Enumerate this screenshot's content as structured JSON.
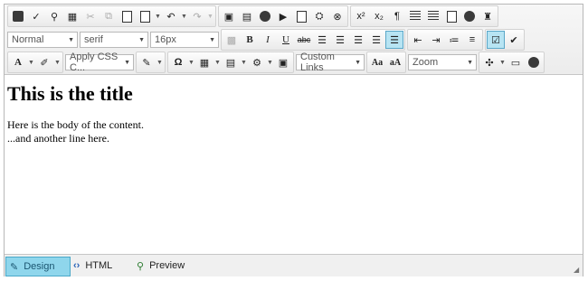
{
  "toolbar": {
    "paragraph_format": "Normal",
    "font_name": "serif",
    "font_size": "16px",
    "css_class": "Apply CSS C...",
    "custom_links": "Custom Links",
    "zoom": "Zoom",
    "bold": "B",
    "italic": "I",
    "underline": "U",
    "strike": "abc",
    "font_color": "A",
    "omega": "Ω",
    "superscript": "x²",
    "subscript": "x₂",
    "font_up": "Aa",
    "font_down": "aA"
  },
  "content": {
    "title": "This is the title",
    "line1": "Here is the body of the content.",
    "line2": "...and another line here."
  },
  "tabs": {
    "design": "Design",
    "html": "HTML",
    "preview": "Preview"
  }
}
